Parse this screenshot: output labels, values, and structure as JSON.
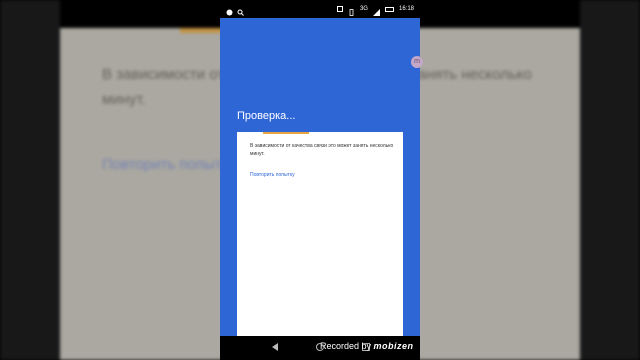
{
  "background": {
    "text": "В зависимости от качества связи это может занять несколько минут.",
    "link": "Повторить попытку"
  },
  "statusbar": {
    "network": "3G",
    "time": "16:18"
  },
  "screen": {
    "title": "Проверка...",
    "message": "В зависимости от качества связи это может занять несколько минут.",
    "retry_link": "Повторить попытку"
  },
  "watermark": {
    "prefix": "Recorded by",
    "brand": "mobizen"
  },
  "colors": {
    "primary": "#2f66d6",
    "accent": "#e9a340",
    "card": "#ffffff"
  }
}
